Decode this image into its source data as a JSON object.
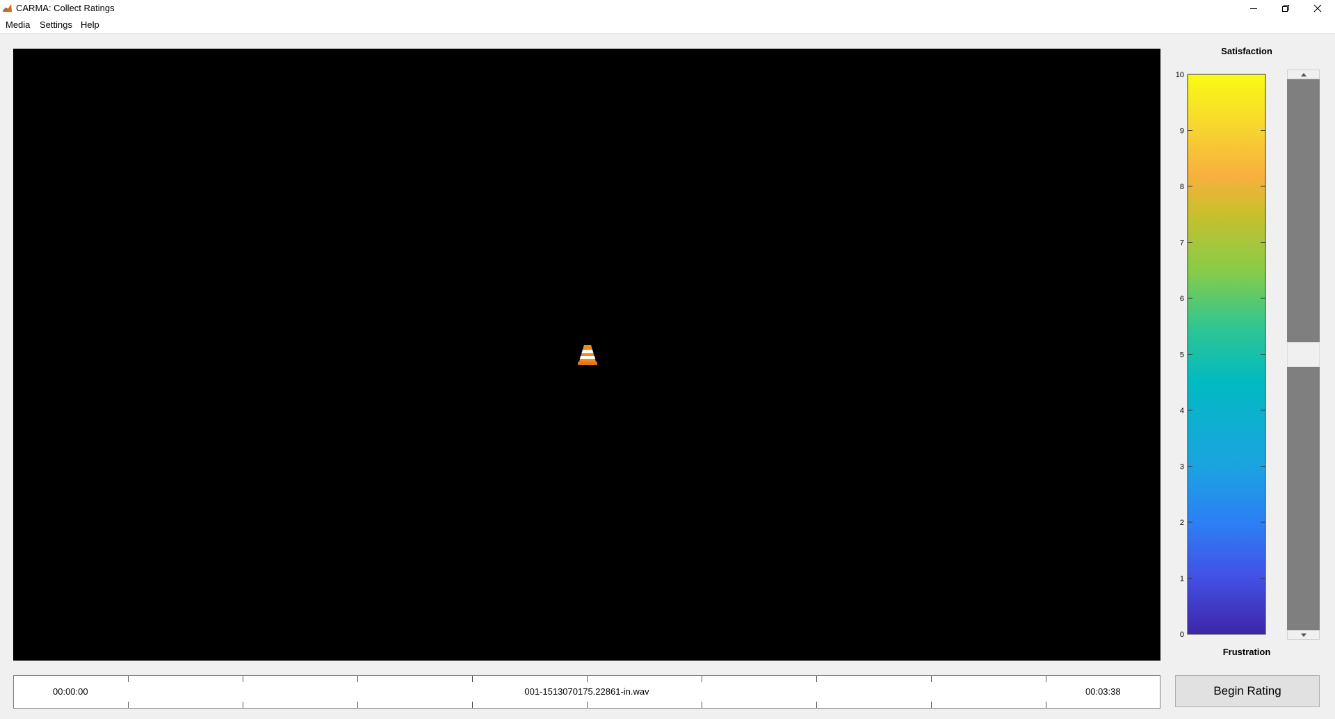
{
  "window": {
    "title": "CARMA: Collect Ratings"
  },
  "menu": {
    "items": [
      "Media",
      "Settings",
      "Help"
    ]
  },
  "video": {
    "state_icon": "vlc-cone-icon"
  },
  "timeline": {
    "start_time": "00:00:00",
    "filename": "001-1513070175.22861-in.wav",
    "end_time": "00:03:38"
  },
  "rating": {
    "top_label": "Satisfaction",
    "bottom_label": "Frustration",
    "scale_min": 0,
    "scale_max": 10,
    "tick_labels": [
      "0",
      "1",
      "2",
      "3",
      "4",
      "5",
      "6",
      "7",
      "8",
      "9",
      "10"
    ],
    "current_value": 5,
    "colormap": "parula",
    "begin_label": "Begin Rating"
  },
  "colors": {
    "video_background": "#000000",
    "colormap_stops": [
      "#3e26a8",
      "#4250e4",
      "#2c80f5",
      "#1ba3e0",
      "#01bac2",
      "#31c690",
      "#88cc48",
      "#c7c02d",
      "#f9b03e",
      "#f7d330",
      "#f9fb15"
    ]
  }
}
